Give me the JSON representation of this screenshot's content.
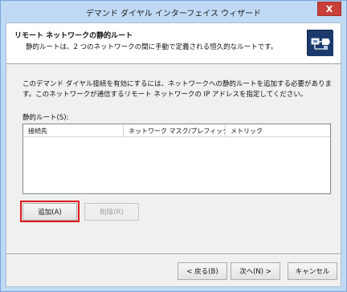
{
  "window": {
    "title": "デマンド ダイヤル インターフェイス ウィザード",
    "close_glyph": "X"
  },
  "header": {
    "title": "リモート ネットワークの静的ルート",
    "subtitle": "静的ルートは、2 つのネットワークの間に手動で定義される恒久的なルートです。",
    "icon": "network-wizard-icon"
  },
  "body": {
    "description": "このデマンド ダイヤル接続を有効にするには、ネットワークへの静的ルートを追加する必要があります。このネットワークが通信するリモート ネットワークの IP アドレスを指定してください。",
    "routes_label": "静的ルート(S):",
    "columns": [
      "接続先",
      "ネットワーク マスク/プレフィックス...",
      "メトリック"
    ],
    "add_button": "追加(A)",
    "delete_button": "削除(R)"
  },
  "footer": {
    "back_button": "< 戻る(B)",
    "next_button": "次へ(N) >",
    "cancel_button": "キャンセル"
  },
  "colors": {
    "highlight": "#e01818",
    "titlebar": "#c0d9f4",
    "close": "#c9403a"
  }
}
